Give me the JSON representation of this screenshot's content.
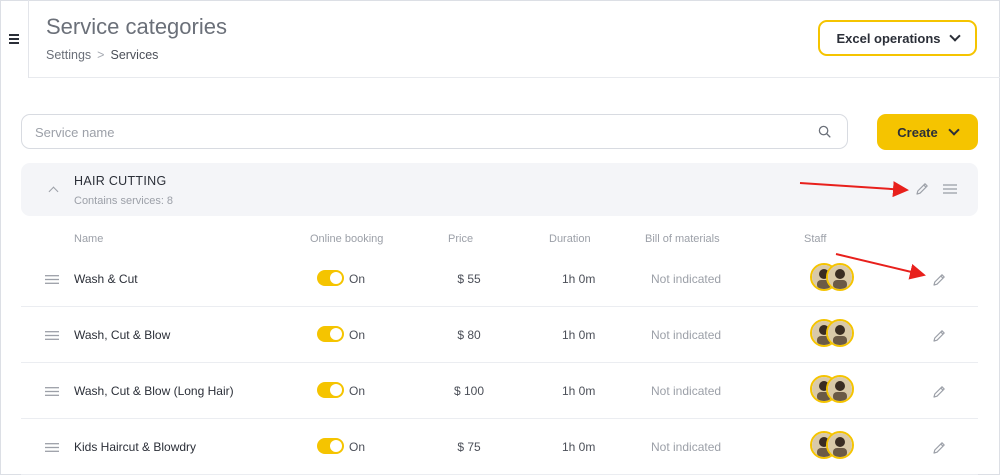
{
  "header": {
    "title": "Service categories",
    "breadcrumb": {
      "parent": "Settings",
      "separator": ">",
      "current": "Services"
    },
    "excel_button": "Excel operations"
  },
  "toolbar": {
    "search_placeholder": "Service name",
    "create_button": "Create"
  },
  "category": {
    "title": "HAIR CUTTING",
    "count_text": "Contains services: 8"
  },
  "columns": {
    "name": "Name",
    "online_booking": "Online booking",
    "price": "Price",
    "duration": "Duration",
    "bill_of_materials": "Bill of materials",
    "staff": "Staff"
  },
  "services": [
    {
      "name": "Wash & Cut",
      "online": "On",
      "price": "$ 55",
      "duration": "1h 0m",
      "bom": "Not indicated"
    },
    {
      "name": "Wash, Cut & Blow",
      "online": "On",
      "price": "$ 80",
      "duration": "1h 0m",
      "bom": "Not indicated"
    },
    {
      "name": "Wash, Cut & Blow (Long Hair)",
      "online": "On",
      "price": "$ 100",
      "duration": "1h 0m",
      "bom": "Not indicated"
    },
    {
      "name": "Kids Haircut & Blowdry",
      "online": "On",
      "price": "$ 75",
      "duration": "1h 0m",
      "bom": "Not indicated"
    }
  ],
  "colors": {
    "accent": "#f5c400",
    "annotation_arrow": "#e8201c"
  }
}
